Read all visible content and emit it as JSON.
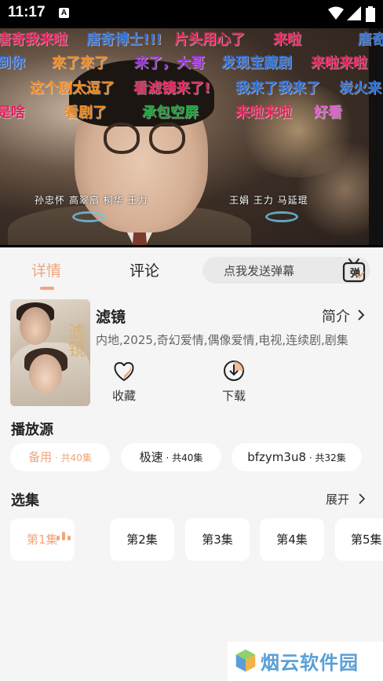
{
  "status_bar": {
    "time": "11:17",
    "notification_badge": "A"
  },
  "video": {
    "credits_left": "孙忠怀  高翠扇  桐华  王力",
    "credits_right": "王娟  王力  马延琨",
    "danmaku": [
      {
        "text": "唐奇我来啦",
        "color": "#e0245e"
      },
      {
        "text": "唐奇博士!!!",
        "color": "#2f6fd6"
      },
      {
        "text": "片头用心了",
        "color": "#e0245e"
      },
      {
        "text": "来啦",
        "color": "#e0245e"
      },
      {
        "text": "唐奇",
        "color": "#2f6fd6"
      },
      {
        "text": "到你",
        "color": "#2f6fd6"
      },
      {
        "text": "來了來了",
        "color": "#f08a24"
      },
      {
        "text": "来了，大哥",
        "color": "#9b30d9"
      },
      {
        "text": "发现宝藏剧",
        "color": "#2f6fd6"
      },
      {
        "text": "来啦来啦",
        "color": "#e0245e"
      },
      {
        "text": "这个剧太逗了",
        "color": "#f08a24"
      },
      {
        "text": "看滤镜来了!",
        "color": "#e0245e"
      },
      {
        "text": "我来了我来了",
        "color": "#2f6fd6"
      },
      {
        "text": "炭火来",
        "color": "#2f6fd6"
      },
      {
        "text": "是啥",
        "color": "#e0245e"
      },
      {
        "text": "看剧了",
        "color": "#f08a24"
      },
      {
        "text": "承包空屏",
        "color": "#1aa33a"
      },
      {
        "text": "来啦来啦",
        "color": "#e0245e"
      },
      {
        "text": "好看",
        "color": "#e05ad0"
      }
    ]
  },
  "tabs": {
    "detail": "详情",
    "comment": "评论",
    "danmaku_placeholder": "点我发送弹幕",
    "danmaku_button": "弹"
  },
  "show": {
    "title": "滤镜",
    "intro_label": "简介",
    "tags": "内地,2025,奇幻爱情,偶像爱情,电视,连续剧,剧集",
    "poster_text": "滤镜"
  },
  "actions": {
    "favorite": "收藏",
    "download": "下载"
  },
  "sources": {
    "title": "播放源",
    "items": [
      {
        "name": "备用",
        "count": " · 共40集",
        "active": true
      },
      {
        "name": "极速",
        "count": " · 共40集",
        "active": false
      },
      {
        "name": "bfzym3u8",
        "count": " · 共32集",
        "active": false
      }
    ]
  },
  "episodes": {
    "title": "选集",
    "expand_label": "展开",
    "items": [
      "第1集",
      "第2集",
      "第3集",
      "第4集",
      "第5集"
    ]
  },
  "watermark": {
    "text": "烟云软件园"
  },
  "colors": {
    "accent": "#f0a57c",
    "background": "#f5f5f5",
    "card": "#ffffff"
  }
}
